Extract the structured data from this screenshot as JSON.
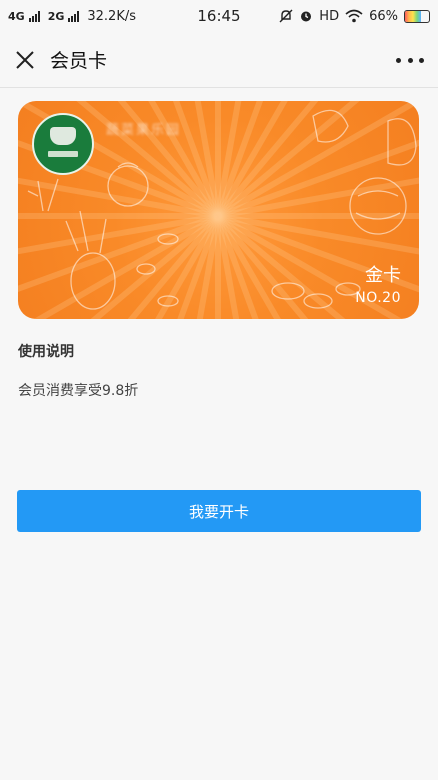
{
  "status_bar": {
    "network_1": "4G",
    "network_2": "2G",
    "speed": "32.2K/s",
    "time": "16:45",
    "hd": "HD",
    "battery": "66%",
    "battery_level": 0.66
  },
  "navbar": {
    "title": "会员卡"
  },
  "card": {
    "shop_name": "蔬菜果乐园",
    "level": "金卡",
    "number": "NO.20",
    "colors": {
      "primary": "#f98a28",
      "logo_bg": "#1a7c3c"
    }
  },
  "instructions": {
    "title": "使用说明",
    "text": "会员消费享受9.8折"
  },
  "action": {
    "open_card_label": "我要开卡",
    "color": "#2399f5"
  }
}
